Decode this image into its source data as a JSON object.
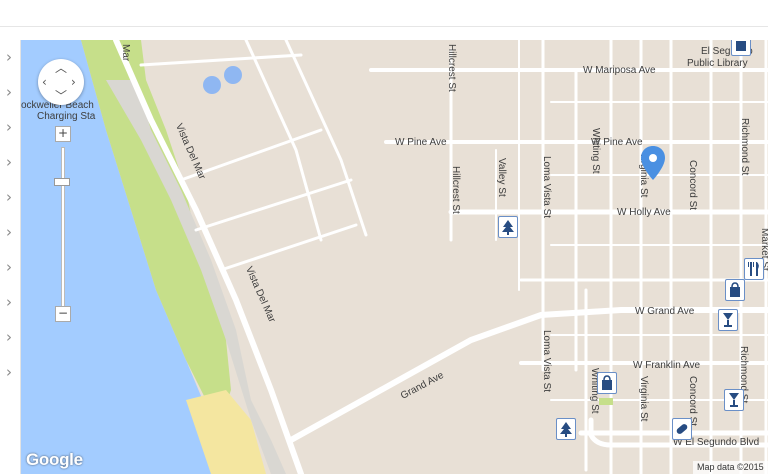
{
  "colors": {
    "land": "#e8e0d6",
    "water": "#a3ccff",
    "park": "#c6df8a",
    "beach": "#f4e6a0",
    "road": "#ffffff",
    "marker": "#4a90e2",
    "poi_icon": "#274c82"
  },
  "map": {
    "streets": [
      "W Mariposa Ave",
      "W Pine Ave",
      "W Pine Ave",
      "W Holly Ave",
      "W Grand Ave",
      "W Franklin Ave",
      "W El Segundo Blvd",
      "Vista Del Mar",
      "Vista Del Mar",
      "Grand Ave",
      "Hillcrest St",
      "Hillcrest St",
      "Valley St",
      "Loma Vista St",
      "Loma Vista St",
      "Whiting St",
      "Whiting St",
      "Virginia St",
      "Virginia St",
      "Concord St",
      "Concord St",
      "Richmond St",
      "Richmond St",
      "Market St",
      "Mar"
    ],
    "places": {
      "library_line1": "El Segundo",
      "library_line2": "Public Library",
      "charging_line1": "ockweller Beach",
      "charging_line2": "Charging Sta"
    },
    "controls": {
      "zoom_in": "+",
      "zoom_out": "−",
      "zoom_mid": "−"
    },
    "icons": {
      "pan": "pan-arrows-icon",
      "marker": "location-marker-icon",
      "park": "tree-icon",
      "shopping": "shopping-bag-icon",
      "bar": "wine-glass-icon",
      "restaurant": "fork-knife-icon",
      "pharmacy": "pill-icon",
      "library": "book-icon"
    },
    "logo": "Google",
    "attribution": "Map data ©2015"
  }
}
